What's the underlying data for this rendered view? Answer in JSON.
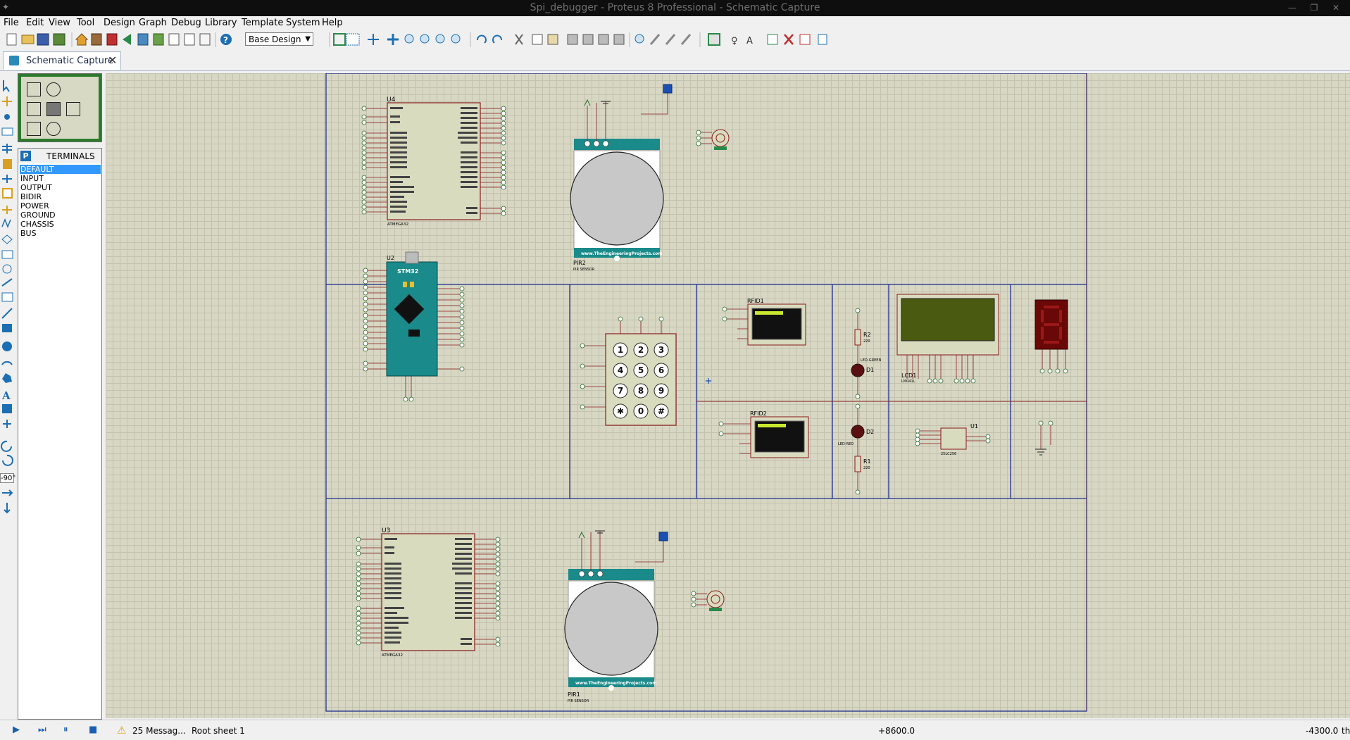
{
  "window": {
    "title": "Spi_debugger - Proteus 8 Professional - Schematic Capture"
  },
  "menu": [
    "File",
    "Edit",
    "View",
    "Tool",
    "Design",
    "Graph",
    "Debug",
    "Library",
    "Template",
    "System",
    "Help"
  ],
  "toolbar": {
    "design_select": "Base Design"
  },
  "tab": {
    "label": "Schematic Capture"
  },
  "left_toolbar": {
    "rotation": "-90°"
  },
  "pin_panel": {
    "header": "TERMINALS",
    "items": [
      "DEFAULT",
      "INPUT",
      "OUTPUT",
      "BIDIR",
      "POWER",
      "GROUND",
      "CHASSIS",
      "BUS"
    ],
    "selected": "DEFAULT"
  },
  "schematic": {
    "components": {
      "u4": {
        "ref": "U4",
        "part": "ATMEGA32"
      },
      "u3": {
        "ref": "U3",
        "part": "ATMEGA32"
      },
      "u2": {
        "ref": "U2",
        "part": "STM32"
      },
      "pir2": {
        "ref": "PIR2",
        "sub": "PIR SENSOR",
        "brand": "www.TheEngineeringProjects.com"
      },
      "pir1": {
        "ref": "PIR1",
        "sub": "PIR SENSOR",
        "brand": "www.TheEngineeringProjects.com"
      },
      "rfid1": {
        "ref": "RFID1"
      },
      "rfid2": {
        "ref": "RFID2"
      },
      "r2": {
        "ref": "R2",
        "value": "220"
      },
      "r1": {
        "ref": "R1",
        "value": "220"
      },
      "d1": {
        "ref": "D1",
        "part": "LED-GREEN"
      },
      "d2": {
        "ref": "D2",
        "part": "LED-RED"
      },
      "lcd1": {
        "ref": "LCD1",
        "part": "LM041L"
      },
      "u1": {
        "ref": "U1",
        "part": "25LC256"
      }
    },
    "keypad_keys": [
      "1",
      "2",
      "3",
      "4",
      "5",
      "6",
      "7",
      "8",
      "9",
      "✱",
      "0",
      "#"
    ]
  },
  "status": {
    "messages": "25 Messag...",
    "sheet": "Root sheet 1",
    "x_coord": "+8600.0",
    "y_coord": "-4300.0",
    "unit": "th"
  },
  "colors": {
    "canvas": "#d7d7c4",
    "grid": "#c2c2ae",
    "frame": "#1f2f8f",
    "wire": "#8a1a1a",
    "chip": "#d9dbbf",
    "pir_teal": "#1a8a8a",
    "selected": "#3399ff"
  }
}
